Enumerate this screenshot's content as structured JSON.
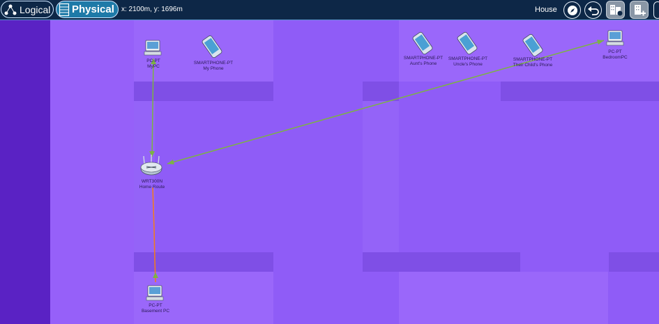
{
  "toolbar": {
    "logical_label": "Logical",
    "physical_label": "Physical",
    "coordinates": "x: 2100m, y: 1696m",
    "location_label": "House"
  },
  "colors": {
    "toolbar_bg": "#0d2747",
    "physical_active": "#1e7aa8",
    "canvas_bg": "#8f5cf7",
    "sidebar": "#5a22c4",
    "wall": "#7f4fe6",
    "wireless_link": "#7cb342",
    "wired_link": "#ef7a24"
  },
  "devices": [
    {
      "id": "mypc",
      "type": "PC-PT",
      "name": "MyPC",
      "icon": "pc-icon"
    },
    {
      "id": "myphone",
      "type": "SMARTPHONE-PT",
      "name": "My Phone",
      "icon": "smartphone-icon"
    },
    {
      "id": "aunt",
      "type": "SMARTPHONE-PT",
      "name": "Aunt's Phone",
      "icon": "smartphone-icon"
    },
    {
      "id": "uncle",
      "type": "SMARTPHONE-PT",
      "name": "Uncle's Phone",
      "icon": "smartphone-icon"
    },
    {
      "id": "child",
      "type": "SMARTPHONE-PT",
      "name": "Their Child's Phone",
      "icon": "smartphone-icon"
    },
    {
      "id": "bedroom",
      "type": "PC-PT",
      "name": "BedroomPC",
      "icon": "pc-icon"
    },
    {
      "id": "router",
      "type": "WRT300N",
      "name": "Home Route",
      "icon": "wireless-router-icon"
    },
    {
      "id": "basement",
      "type": "PC-PT",
      "name": "Basement PC",
      "icon": "pc-icon"
    }
  ],
  "links": [
    {
      "from": "mypc",
      "to": "router",
      "kind": "wireless"
    },
    {
      "from": "bedroom",
      "to": "router",
      "kind": "wireless"
    },
    {
      "from": "basement",
      "to": "router",
      "kind": "wired"
    }
  ]
}
